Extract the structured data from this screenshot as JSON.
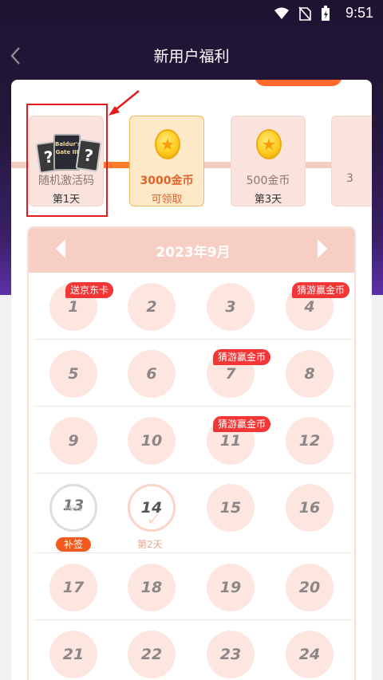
{
  "status_bar": {
    "time": "9:51"
  },
  "nav": {
    "title": "新用户福利"
  },
  "rewards": [
    {
      "label": "随机激活码",
      "sub": "第1天",
      "type": "cards"
    },
    {
      "label": "3000金币",
      "sub": "可领取",
      "type": "coin",
      "highlight": true
    },
    {
      "label": "500金币",
      "sub": "第3天",
      "type": "coin"
    },
    {
      "label": "3",
      "sub": "",
      "type": "partial"
    }
  ],
  "card_art_text": "Baldur's Gate III",
  "calendar": {
    "month": "2023年9月",
    "rows": [
      [
        {
          "n": "1",
          "tag": "送京东卡"
        },
        {
          "n": "2"
        },
        {
          "n": "3"
        },
        {
          "n": "4",
          "tag": "猜游赢金币"
        }
      ],
      [
        {
          "n": "5"
        },
        {
          "n": "6"
        },
        {
          "n": "7",
          "tag": "猜游赢金币"
        },
        {
          "n": "8"
        }
      ],
      [
        {
          "n": "9"
        },
        {
          "n": "10"
        },
        {
          "n": "11",
          "tag": "猜游赢金币"
        },
        {
          "n": "12"
        }
      ],
      [
        {
          "n": "13",
          "state": "missed",
          "miss": "Miss",
          "action": "补签"
        },
        {
          "n": "14",
          "state": "current",
          "caption": "第2天"
        },
        {
          "n": "15"
        },
        {
          "n": "16"
        }
      ],
      [
        {
          "n": "17"
        },
        {
          "n": "18"
        },
        {
          "n": "19"
        },
        {
          "n": "20"
        }
      ],
      [
        {
          "n": "21"
        },
        {
          "n": "22"
        },
        {
          "n": "23"
        },
        {
          "n": "24"
        }
      ]
    ]
  },
  "colors": {
    "accent": "#ff6a2a",
    "tag_red": "#f43636",
    "header_dark": "#1d1431"
  }
}
